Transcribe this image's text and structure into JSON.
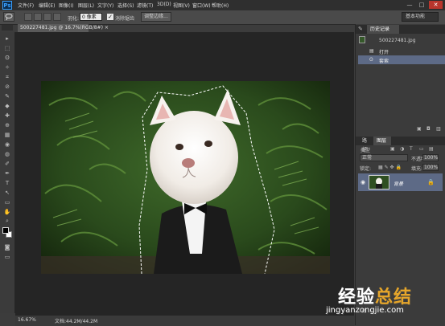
{
  "app": {
    "logo": "Ps"
  },
  "menus": [
    "文件(F)",
    "编辑(E)",
    "图像(I)",
    "图层(L)",
    "文字(Y)",
    "选择(S)",
    "滤镜(T)",
    "3D(D)",
    "视图(V)",
    "窗口(W)",
    "帮助(H)"
  ],
  "window_controls": {
    "minimize": "—",
    "maximize": "□",
    "close": "✕"
  },
  "options_bar": {
    "feather_label": "羽化:",
    "feather_value": "0 像素",
    "antialias_label": "消除锯齿",
    "antialias_checked": true,
    "refine_edge_button": "调整边缘...",
    "workspace_select": "基本功能"
  },
  "document": {
    "tab_title": "500227481.jpg @ 16.7%(RGB/8#)",
    "tab_close": "×",
    "zoom": "16.67%",
    "doc_size": "文档:44.2M/44.2M"
  },
  "tools": [
    "▸",
    "⬚",
    "ʘ",
    "✧",
    "⌗",
    "⊘",
    "✎",
    "◆",
    "✚",
    "⊕",
    "▦",
    "◉",
    "◍",
    "✐",
    "T",
    "↖",
    "▭",
    "✋",
    "🔍"
  ],
  "colors": {
    "foreground": "#000000",
    "background": "#ffffff",
    "selection_highlight": "#5d6a86"
  },
  "history_panel": {
    "tabs": [
      {
        "label": "历史记录",
        "active": true
      }
    ],
    "snapshot": "500227481.jpg",
    "items": [
      {
        "label": "打开",
        "selected": false
      },
      {
        "label": "套索",
        "selected": true
      }
    ]
  },
  "layers_panel": {
    "tabs": [
      {
        "label": "路径",
        "active": false
      },
      {
        "label": "图层",
        "active": true
      }
    ],
    "kind_filter": "类型",
    "blend_mode": "正常",
    "opacity_label": "不透明度:",
    "opacity_value": "100%",
    "lock_label": "锁定:",
    "fill_label": "填充:",
    "fill_value": "100%",
    "layers": [
      {
        "name": "背景",
        "visible": true,
        "locked": true
      }
    ]
  },
  "watermark": {
    "title_part1": "经验",
    "title_part2": "总结",
    "url": "jingyanzongjie.com"
  }
}
